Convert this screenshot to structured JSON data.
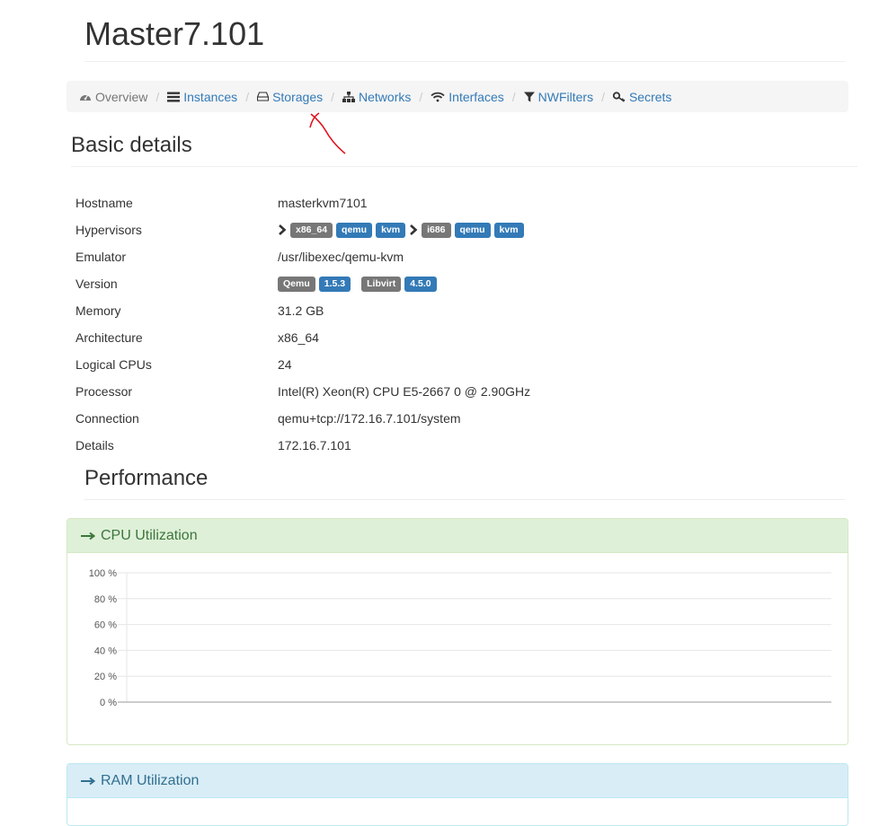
{
  "page": {
    "title": "Master7.101"
  },
  "nav": {
    "items": [
      {
        "label": "Overview",
        "icon": "dashboard-icon",
        "active": true
      },
      {
        "label": "Instances",
        "icon": "list-icon",
        "active": false
      },
      {
        "label": "Storages",
        "icon": "hdd-icon",
        "active": false
      },
      {
        "label": "Networks",
        "icon": "sitemap-icon",
        "active": false
      },
      {
        "label": "Interfaces",
        "icon": "wifi-icon",
        "active": false
      },
      {
        "label": "NWFilters",
        "icon": "filter-icon",
        "active": false
      },
      {
        "label": "Secrets",
        "icon": "key-icon",
        "active": false
      }
    ],
    "separator": "/"
  },
  "basic_details": {
    "heading": "Basic details",
    "rows": {
      "hostname": {
        "label": "Hostname",
        "value": "masterkvm7101"
      },
      "hypervisors": {
        "label": "Hypervisors",
        "groups": [
          {
            "arch": "x86_64",
            "machines": [
              "qemu",
              "kvm"
            ]
          },
          {
            "arch": "i686",
            "machines": [
              "qemu",
              "kvm"
            ]
          }
        ]
      },
      "emulator": {
        "label": "Emulator",
        "value": "/usr/libexec/qemu-kvm"
      },
      "version": {
        "label": "Version",
        "qemu_name": "Qemu",
        "qemu_version": "1.5.3",
        "libvirt_name": "Libvirt",
        "libvirt_version": "4.5.0"
      },
      "memory": {
        "label": "Memory",
        "value": "31.2 GB"
      },
      "architecture": {
        "label": "Architecture",
        "value": "x86_64"
      },
      "logical_cpus": {
        "label": "Logical CPUs",
        "value": "24"
      },
      "processor": {
        "label": "Processor",
        "value": "Intel(R) Xeon(R) CPU E5-2667 0 @ 2.90GHz"
      },
      "connection": {
        "label": "Connection",
        "value": "qemu+tcp://172.16.7.101/system"
      },
      "details": {
        "label": "Details",
        "value": "172.16.7.101"
      }
    }
  },
  "performance": {
    "heading": "Performance",
    "cpu_panel": {
      "title": "CPU Utilization",
      "icon": "arrow-right-icon"
    },
    "ram_panel": {
      "title": "RAM Utilization",
      "icon": "arrow-right-icon"
    }
  },
  "colors": {
    "link": "#337ab7",
    "label_gray": "#777777",
    "label_blue": "#337ab7",
    "success_bg": "#dff0d8",
    "info_bg": "#d9edf7",
    "annotation": "#e0141e"
  },
  "chart_data": {
    "type": "line",
    "title": "",
    "xlabel": "",
    "ylabel": "",
    "ylim": [
      0,
      100
    ],
    "yticks": [
      "100 %",
      "80 %",
      "60 %",
      "40 %",
      "20 %",
      "0 %"
    ],
    "ytick_values": [
      100,
      80,
      60,
      40,
      20,
      0
    ],
    "series": [],
    "grid": true
  }
}
